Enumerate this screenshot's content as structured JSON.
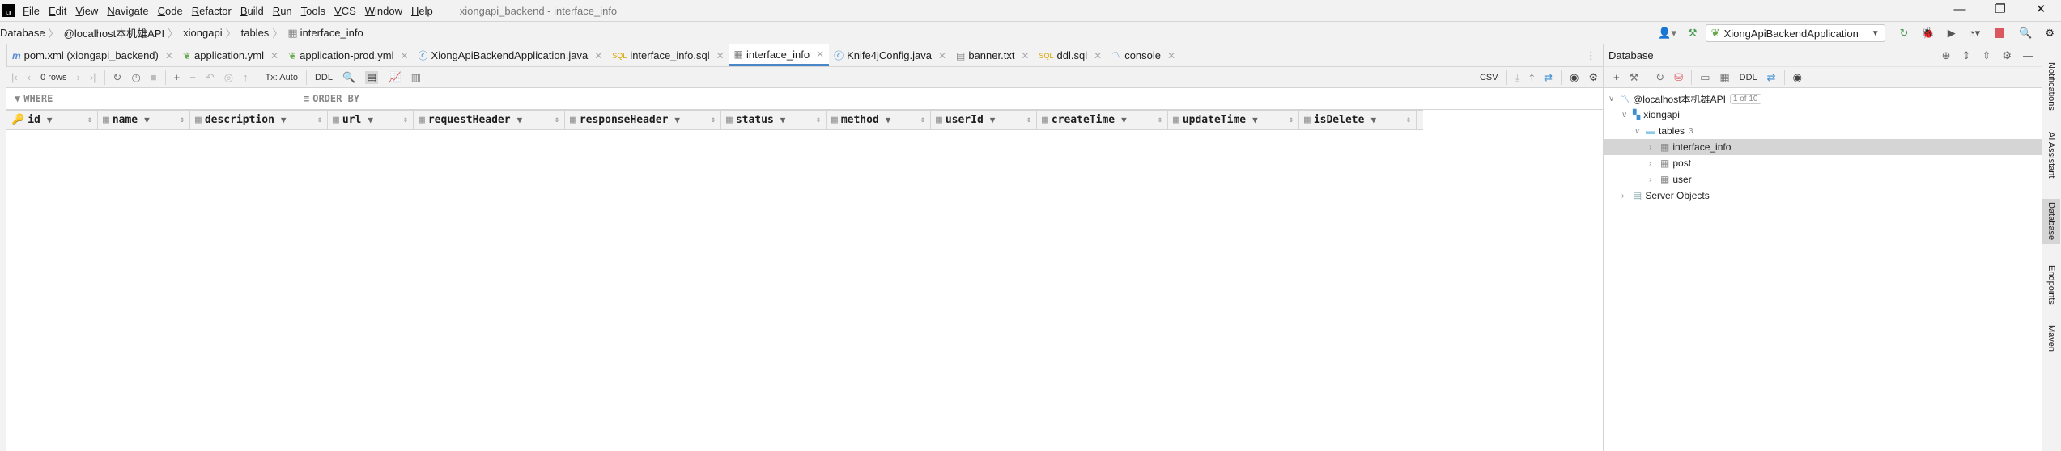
{
  "menubar": {
    "items": [
      "File",
      "Edit",
      "View",
      "Navigate",
      "Code",
      "Refactor",
      "Build",
      "Run",
      "Tools",
      "VCS",
      "Window",
      "Help"
    ],
    "title": "xiongapi_backend - interface_info"
  },
  "breadcrumb": [
    "Database",
    "@localhost本机雄API",
    "xiongapi",
    "tables",
    "interface_info"
  ],
  "run_config": "XiongApiBackendApplication",
  "tabs": [
    {
      "label": "pom.xml (xiongapi_backend)",
      "icon": "maven-icon"
    },
    {
      "label": "application.yml",
      "icon": "spring-icon"
    },
    {
      "label": "application-prod.yml",
      "icon": "spring-icon"
    },
    {
      "label": "XiongApiBackendApplication.java",
      "icon": "class-icon"
    },
    {
      "label": "interface_info.sql",
      "icon": "sql-icon"
    },
    {
      "label": "interface_info",
      "icon": "table-icon",
      "active": true
    },
    {
      "label": "Knife4jConfig.java",
      "icon": "class-icon"
    },
    {
      "label": "banner.txt",
      "icon": "text-file-icon"
    },
    {
      "label": "ddl.sql",
      "icon": "sql-icon"
    },
    {
      "label": "console",
      "icon": "mysql-icon"
    }
  ],
  "toolbar": {
    "rows": "0 rows",
    "tx": "Tx: Auto",
    "ddl": "DDL",
    "export": "CSV"
  },
  "filter": {
    "where": "WHERE",
    "order_by": "ORDER BY"
  },
  "columns": [
    "id",
    "name",
    "description",
    "url",
    "requestHeader",
    "responseHeader",
    "status",
    "method",
    "userId",
    "createTime",
    "updateTime",
    "isDelete"
  ],
  "db_panel": {
    "title": "Database",
    "ddl": "DDL",
    "tree": {
      "connection": "@localhost本机雄API",
      "connection_badge": "1 of 10",
      "schema": "xiongapi",
      "folder": "tables",
      "folder_count": "3",
      "tables": [
        "interface_info",
        "post",
        "user"
      ],
      "server_objects": "Server Objects"
    }
  },
  "right_strip": [
    "Notifications",
    "AI Assistant",
    "Database",
    "Endpoints",
    "Maven"
  ],
  "colors": {
    "accent": "#4a86c8",
    "selected_row": "#d5d5d5",
    "stop": "#db5860",
    "run": "#499c54"
  }
}
